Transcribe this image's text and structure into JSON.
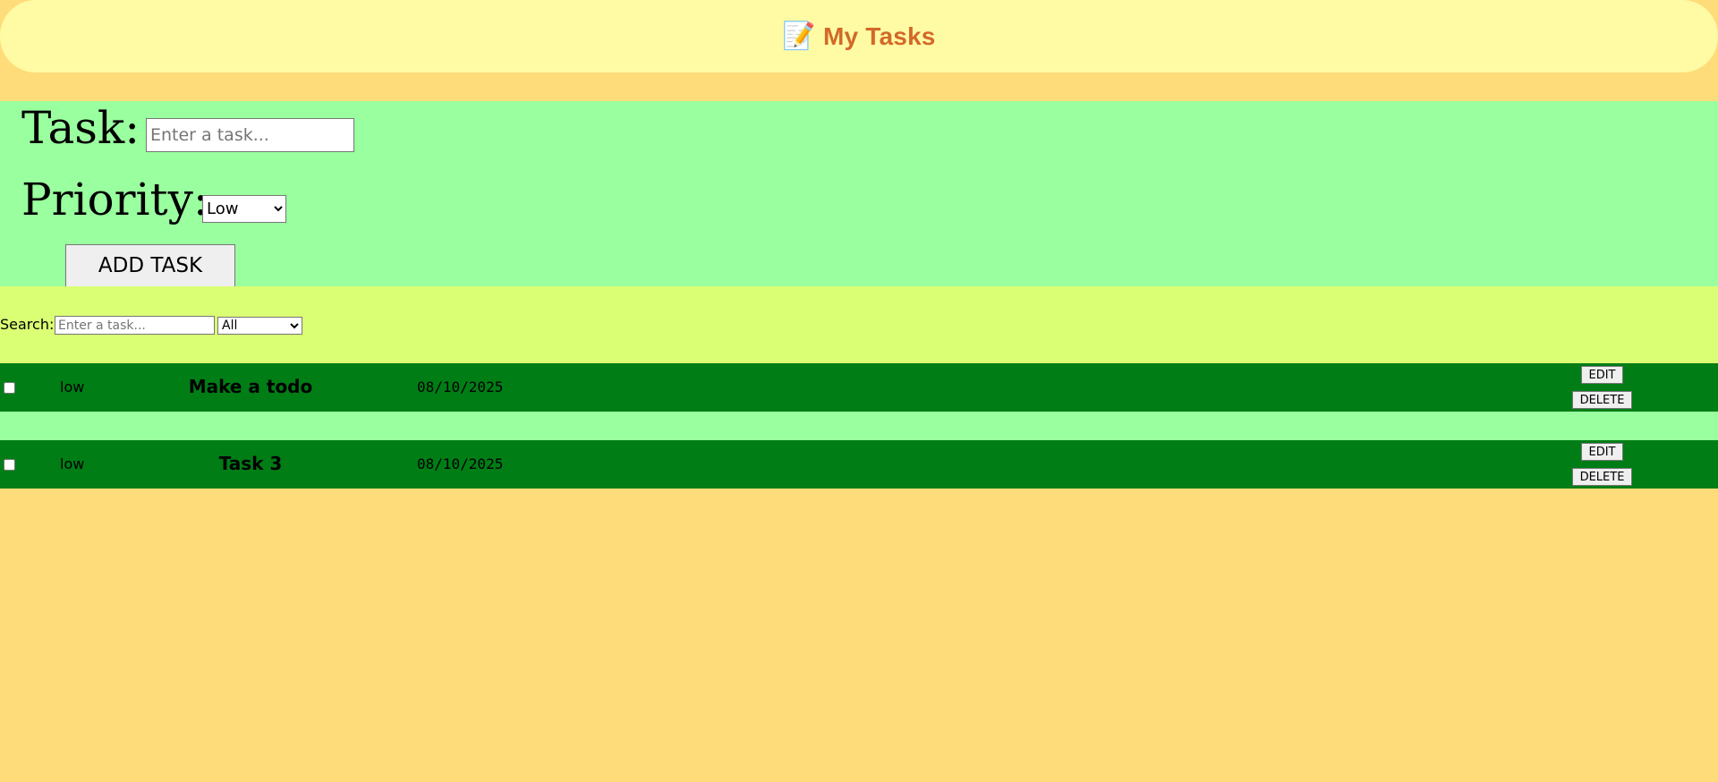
{
  "header": {
    "emoji": "📝",
    "title": "My Tasks"
  },
  "form": {
    "task_label": "Task:",
    "task_placeholder": "Enter a task...",
    "task_value": "",
    "priority_label": "Priority:",
    "priority_selected": "Low",
    "priority_options": [
      "Low"
    ],
    "add_button_label": "ADD TASK"
  },
  "search": {
    "label": "Search:",
    "placeholder": "Enter a task...",
    "value": "",
    "filter_selected": "All",
    "filter_options": [
      "All"
    ]
  },
  "tasks": [
    {
      "checked": false,
      "priority": "low",
      "name": "Make a todo",
      "date": "08/10/2025",
      "edit_label": "EDIT",
      "delete_label": "DELETE"
    },
    {
      "checked": false,
      "priority": "low",
      "name": "Task 3",
      "date": "08/10/2025",
      "edit_label": "EDIT",
      "delete_label": "DELETE"
    }
  ],
  "colors": {
    "page_bg": "#ffdc7a",
    "header_bg": "#fffba4",
    "title_color": "#d2692a",
    "form_bg": "#9aff9f",
    "search_bg": "#daff74",
    "row_bg": "#007d15"
  }
}
